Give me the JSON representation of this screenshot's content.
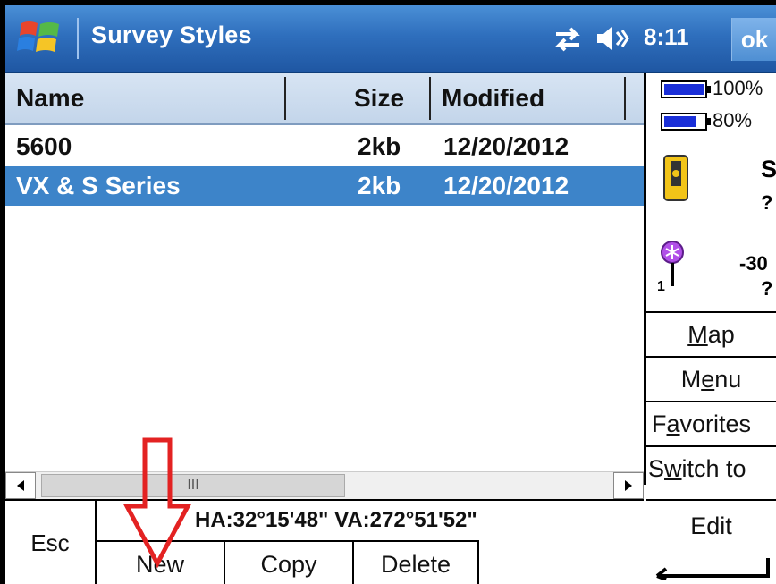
{
  "titlebar": {
    "title": "Survey Styles",
    "clock": "8:11",
    "ok_label": "ok",
    "icons": [
      "windows-start-icon",
      "connectivity-icon",
      "volume-icon"
    ]
  },
  "list": {
    "columns": [
      "Name",
      "Size",
      "Modified"
    ],
    "rows": [
      {
        "name": "5600",
        "size": "2kb",
        "modified": "12/20/2012",
        "selected": false
      },
      {
        "name": "VX & S Series",
        "size": "2kb",
        "modified": "12/20/2012",
        "selected": true
      }
    ],
    "scroll_thumb": "III"
  },
  "status": {
    "angles": "HA:32°15'48\"  VA:272°51'52\""
  },
  "softkeys": {
    "esc": "Esc",
    "new": "New",
    "copy": "Copy",
    "delete": "Delete"
  },
  "right_panel": {
    "battery1": "100%",
    "battery2": "80%",
    "battery1_level": 1.0,
    "battery2_level": 0.8,
    "instrument_letter": "S",
    "instrument_status": "?",
    "target_value": "-30",
    "target_status": "?",
    "target_index": "1",
    "map_prefix": "",
    "map_hot": "M",
    "map_rest": "ap",
    "menu_pre": "M",
    "menu_hot": "e",
    "menu_rest": "nu",
    "fav_pre": "F",
    "fav_hot": "a",
    "fav_rest": "vorites",
    "switch_pre": "S",
    "switch_hot": "w",
    "switch_rest": "itch to",
    "edit": "Edit"
  },
  "colors": {
    "titlebar": "#2f6fbd",
    "selection": "#3d84c9",
    "annotation_arrow": "#e32222",
    "battery_fill": "#1a2fd8"
  }
}
